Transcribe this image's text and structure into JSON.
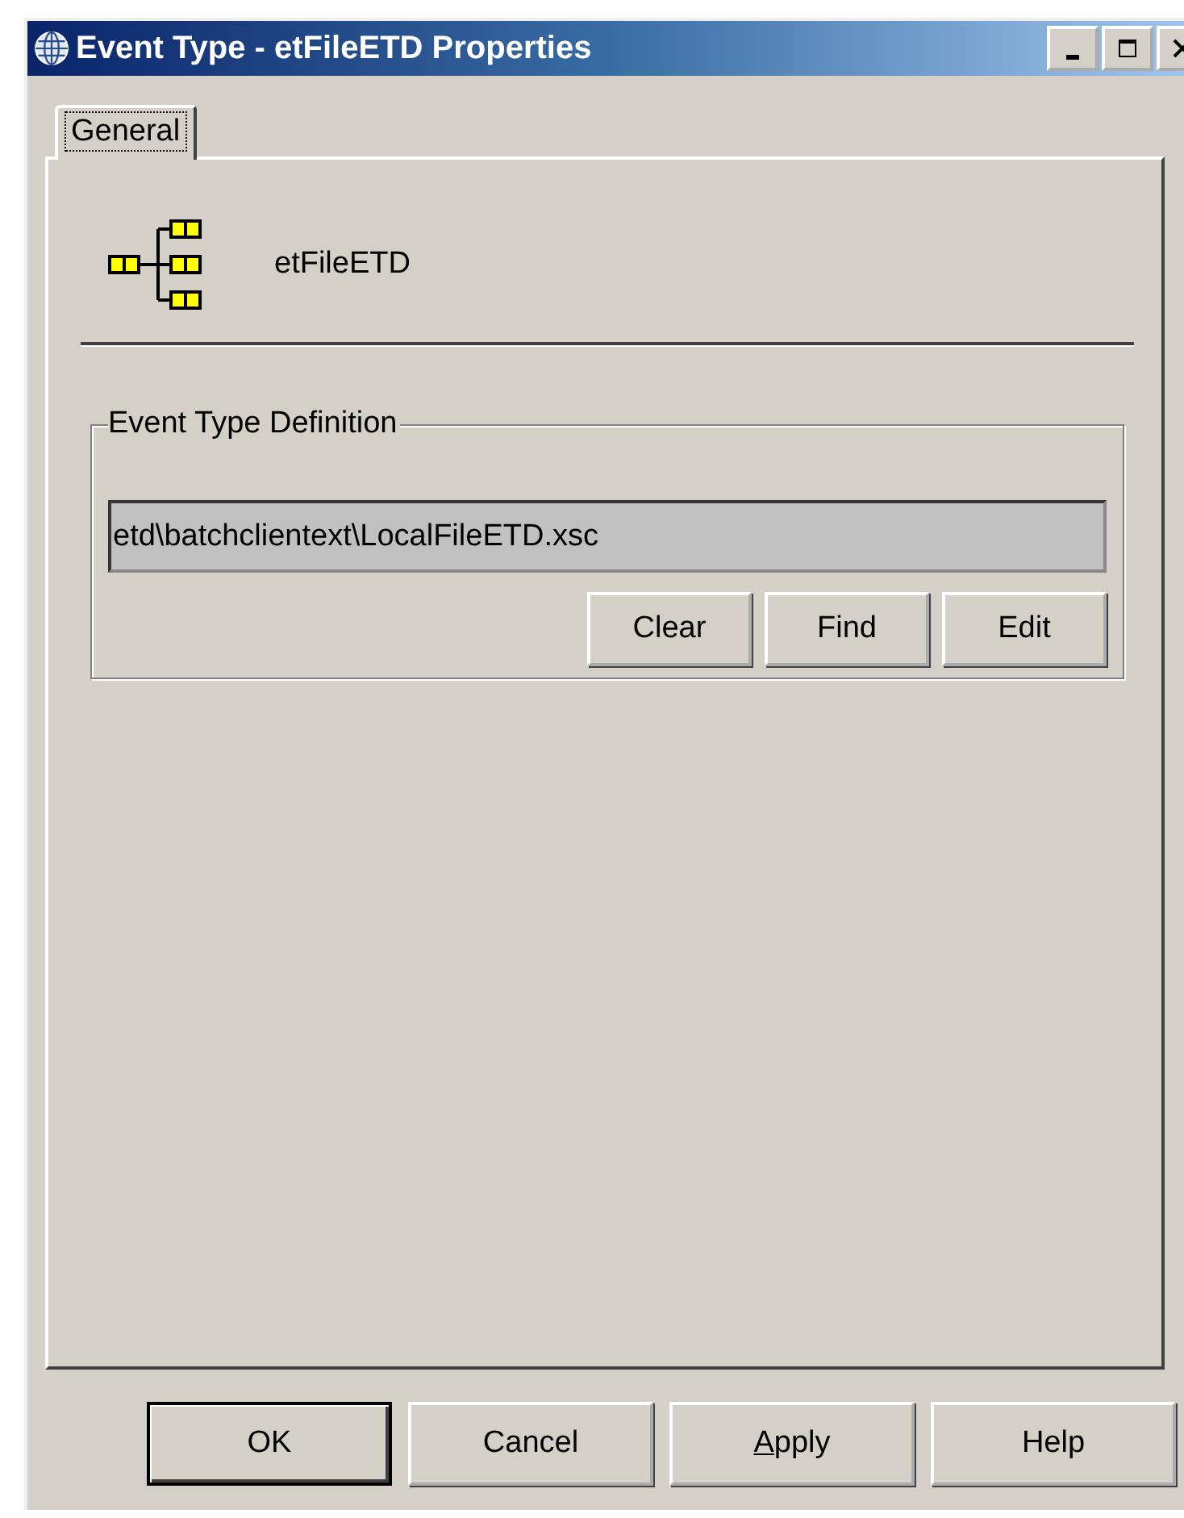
{
  "window": {
    "title": "Event Type - etFileETD Properties"
  },
  "tabs": [
    {
      "label": "General",
      "selected": true
    }
  ],
  "header": {
    "name": "etFileETD"
  },
  "group": {
    "title": "Event Type Definition",
    "field_value": "etd\\batchclientext\\LocalFileETD.xsc",
    "buttons": [
      "Clear",
      "Find",
      "Edit"
    ]
  },
  "buttons": [
    {
      "label": "OK",
      "default": true
    },
    {
      "label": "Cancel",
      "default": false
    },
    {
      "label": "Apply",
      "default": false,
      "first_letter_underlined": true
    },
    {
      "label": "Help",
      "default": false
    }
  ]
}
